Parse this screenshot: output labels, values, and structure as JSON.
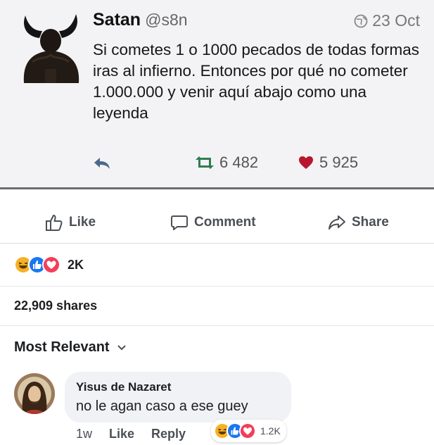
{
  "tweet": {
    "name": "Satan",
    "handle": "@s8n",
    "date": "23 Oct",
    "text": "Si cometes 1 o 1000 pecados de todas formas iras al infierno. Entonces por qué no cometer 1.000.000 y venir aquí abajo como una leyenda",
    "retweets": "6 482",
    "likes": "5 925",
    "icons": {
      "avatar": "devil-avatar",
      "date": "globe-icon",
      "reply": "reply-icon",
      "retweet": "retweet-icon",
      "like": "heart-icon"
    },
    "colors": {
      "retweet": "#2e7d4f",
      "heart": "#b8162f"
    }
  },
  "post_actions": {
    "like_label": "Like",
    "comment_label": "Comment",
    "share_label": "Share"
  },
  "reactions": {
    "count": "2K",
    "types": [
      "haha",
      "like",
      "love"
    ]
  },
  "shares": "22,909 shares",
  "comments_filter": "Most Relevant",
  "comment": {
    "author": "Yisus de Nazaret",
    "text": "no le agan caso a ese guey",
    "time": "1w",
    "like_label": "Like",
    "reply_label": "Reply",
    "reaction_count": "1.2K"
  },
  "colors": {
    "fb_blue": "#1877f2",
    "love_red": "#f33e58",
    "haha_yellow": "#f7b125"
  }
}
